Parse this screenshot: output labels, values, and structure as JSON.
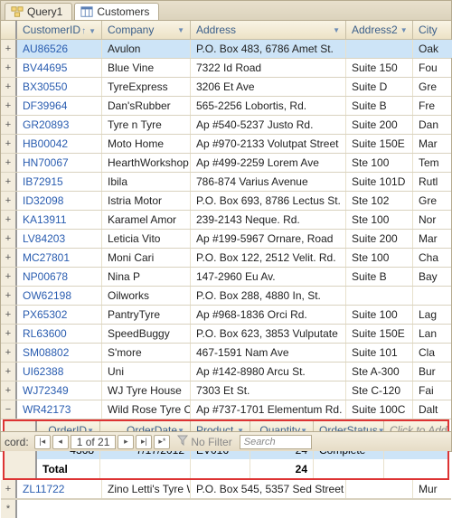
{
  "tabs": [
    {
      "label": "Query1",
      "active": false
    },
    {
      "label": "Customers",
      "active": true
    }
  ],
  "columns": [
    "CustomerID",
    "Company",
    "Address",
    "Address2",
    "City"
  ],
  "rows": [
    {
      "id": "AU86526",
      "company": "Avulon",
      "addr": "P.O. Box 483, 6786 Amet St.",
      "addr2": "",
      "city": "Oak",
      "selected": true
    },
    {
      "id": "BV44695",
      "company": "Blue Vine",
      "addr": "7322 Id Road",
      "addr2": "Suite 150",
      "city": "Fou"
    },
    {
      "id": "BX30550",
      "company": "TyreExpress",
      "addr": "3206 Et Ave",
      "addr2": "Suite D",
      "city": "Gre"
    },
    {
      "id": "DF39964",
      "company": "Dan'sRubber",
      "addr": "565-2256 Lobortis, Rd.",
      "addr2": "Suite B",
      "city": "Fre"
    },
    {
      "id": "GR20893",
      "company": "Tyre n Tyre",
      "addr": "Ap #540-5237 Justo Rd.",
      "addr2": "Suite 200",
      "city": "Dan"
    },
    {
      "id": "HB00042",
      "company": "Moto Home",
      "addr": "Ap #970-2133 Volutpat Street",
      "addr2": "Suite 150E",
      "city": "Mar"
    },
    {
      "id": "HN70067",
      "company": "HearthWorkshop",
      "addr": "Ap #499-2259 Lorem Ave",
      "addr2": "Ste 100",
      "city": "Tem"
    },
    {
      "id": "IB72915",
      "company": "Ibila",
      "addr": "786-874 Varius Avenue",
      "addr2": "Suite 101D",
      "city": "Rutl"
    },
    {
      "id": "ID32098",
      "company": "Istria Motor",
      "addr": "P.O. Box 693, 8786 Lectus St.",
      "addr2": "Ste 102",
      "city": "Gre"
    },
    {
      "id": "KA13911",
      "company": "Karamel Amor",
      "addr": "239-2143 Neque. Rd.",
      "addr2": "Ste 100",
      "city": "Nor"
    },
    {
      "id": "LV84203",
      "company": "Leticia Vito",
      "addr": "Ap #199-5967 Ornare, Road",
      "addr2": "Suite 200",
      "city": "Mar"
    },
    {
      "id": "MC27801",
      "company": "Moni Cari",
      "addr": "P.O. Box 122, 2512 Velit. Rd.",
      "addr2": "Ste 100",
      "city": "Cha"
    },
    {
      "id": "NP00678",
      "company": "Nina P",
      "addr": "147-2960 Eu Av.",
      "addr2": "Suite B",
      "city": "Bay"
    },
    {
      "id": "OW62198",
      "company": "Oilworks",
      "addr": "P.O. Box 288, 4880 In, St.",
      "addr2": "",
      "city": ""
    },
    {
      "id": "PX65302",
      "company": "PantryTyre",
      "addr": "Ap #968-1836 Orci Rd.",
      "addr2": "Suite 100",
      "city": "Lag"
    },
    {
      "id": "RL63600",
      "company": "SpeedBuggy",
      "addr": "P.O. Box 623, 3853 Vulputate",
      "addr2": "Suite 150E",
      "city": "Lan"
    },
    {
      "id": "SM08802",
      "company": "S'more",
      "addr": "467-1591 Nam Ave",
      "addr2": "Suite 101",
      "city": "Cla"
    },
    {
      "id": "UI62388",
      "company": "Uni",
      "addr": "Ap #142-8980 Arcu St.",
      "addr2": "Ste A-300",
      "city": "Bur"
    },
    {
      "id": "WJ72349",
      "company": "WJ Tyre House",
      "addr": "7303 Et St.",
      "addr2": "Ste C-120",
      "city": "Fai"
    },
    {
      "id": "WR42173",
      "company": "Wild Rose Tyre Co.",
      "addr": "Ap #737-1701 Elementum Rd.",
      "addr2": "Suite 100C",
      "city": "Dalt",
      "expanded": true
    },
    {
      "id": "ZL11722",
      "company": "Zino Letti's Tyre W",
      "addr": "P.O. Box 545, 5357 Sed Street",
      "addr2": "",
      "city": "Mur"
    }
  ],
  "sub": {
    "columns": [
      "OrderID",
      "OrderDate",
      "Product",
      "Quantity",
      "OrderStatus"
    ],
    "addLabel": "Click to Add",
    "rows": [
      {
        "orderId": "4368",
        "date": "7/17/2012",
        "product": "EV016",
        "qty": "24",
        "status": "Complete"
      }
    ],
    "totalLabel": "Total",
    "totalQty": "24"
  },
  "nav": {
    "recordLabel": "cord:",
    "position": "1 of 21",
    "filter": "No Filter",
    "searchPlaceholder": "Search"
  }
}
